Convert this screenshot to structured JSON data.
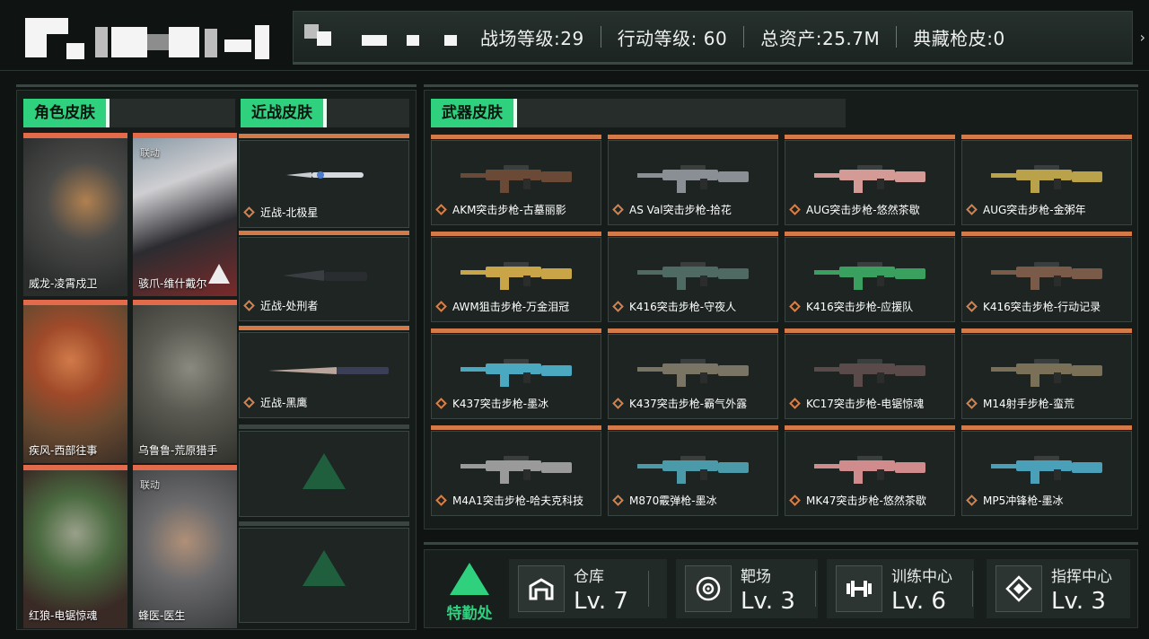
{
  "header": {
    "stats": [
      {
        "label": "战场等级:29"
      },
      {
        "label": "行动等级: 60"
      },
      {
        "label": "总资产:25.7M"
      },
      {
        "label": "典藏枪皮:0"
      }
    ]
  },
  "sections": {
    "character": "角色皮肤",
    "melee": "近战皮肤",
    "weapon": "武器皮肤"
  },
  "characters": [
    {
      "name": "威龙-凌霄戍卫",
      "tag": ""
    },
    {
      "name": "骇爪-维什戴尔",
      "tag": "联动"
    },
    {
      "name": "疾风-西部往事",
      "tag": ""
    },
    {
      "name": "乌鲁鲁-荒原猎手",
      "tag": ""
    },
    {
      "name": "红狼-电锯惊魂",
      "tag": ""
    },
    {
      "name": "蜂医-医生",
      "tag": "联动"
    }
  ],
  "melee": [
    {
      "name": "近战-北极星"
    },
    {
      "name": "近战-处刑者"
    },
    {
      "name": "近战-黑鹰"
    }
  ],
  "weapons": [
    {
      "name": "AKM突击步枪-古墓丽影",
      "color": "#6a4a36"
    },
    {
      "name": "AS Val突击步枪-拾花",
      "color": "#8a8f96"
    },
    {
      "name": "AUG突击步枪-悠然茶歇",
      "color": "#d49a96"
    },
    {
      "name": "AUG突击步枪-金粥年",
      "color": "#b9a24a"
    },
    {
      "name": "AWM狙击步枪-万金泪冠",
      "color": "#c9a548"
    },
    {
      "name": "K416突击步枪-守夜人",
      "color": "#4f6a62"
    },
    {
      "name": "K416突击步枪-应援队",
      "color": "#3aa060"
    },
    {
      "name": "K416突击步枪-行动记录",
      "color": "#7a5a48"
    },
    {
      "name": "K437突击步枪-墨冰",
      "color": "#4aa8c0"
    },
    {
      "name": "K437突击步枪-霸气外露",
      "color": "#7a7464"
    },
    {
      "name": "KC17突击步枪-电锯惊魂",
      "color": "#5a4a4a"
    },
    {
      "name": "M14射手步枪-蛮荒",
      "color": "#7a7058"
    },
    {
      "name": "M4A1突击步枪-哈夫克科技",
      "color": "#9a9a9a"
    },
    {
      "name": "M870霰弹枪-墨冰",
      "color": "#4a9aaa"
    },
    {
      "name": "MK47突击步枪-悠然茶歇",
      "color": "#d08c8c"
    },
    {
      "name": "MP5冲锋枪-墨冰",
      "color": "#4aa0b8"
    }
  ],
  "footer": {
    "department": "特勤处",
    "facilities": [
      {
        "name": "仓库",
        "level": "Lv. 7",
        "icon": "warehouse-icon"
      },
      {
        "name": "靶场",
        "level": "Lv. 3",
        "icon": "target-icon"
      },
      {
        "name": "训练中心",
        "level": "Lv. 6",
        "icon": "dumbbell-icon"
      },
      {
        "name": "指挥中心",
        "level": "Lv. 3",
        "icon": "command-icon"
      }
    ]
  }
}
